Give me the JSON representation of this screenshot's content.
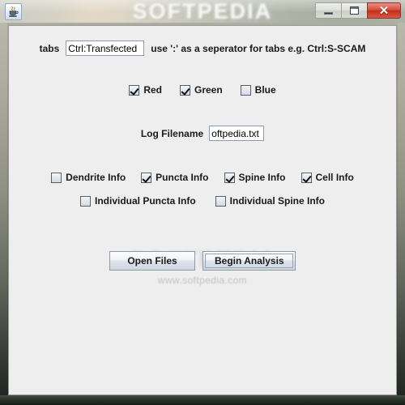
{
  "window": {
    "title_watermark": "SOFTPEDIA",
    "app_icon": "java-coffee-cup-icon",
    "minimize_label": "",
    "maximize_label": "",
    "close_label": "✕"
  },
  "form": {
    "tabs_label": "tabs",
    "tabs_value": "Ctrl:Transfected",
    "tabs_hint": "use ':' as a seperator for tabs e.g. Ctrl:S-SCAM",
    "log_label": "Log Filename",
    "log_value": "oftpedia.txt",
    "channels": [
      {
        "label": "Red",
        "checked": true
      },
      {
        "label": "Green",
        "checked": true
      },
      {
        "label": "Blue",
        "checked": false
      }
    ],
    "info_options": [
      {
        "label": "Dendrite Info",
        "checked": false
      },
      {
        "label": "Puncta Info",
        "checked": true
      },
      {
        "label": "Spine Info",
        "checked": true
      },
      {
        "label": "Cell Info",
        "checked": true
      }
    ],
    "individual_options": [
      {
        "label": "Individual Puncta Info",
        "checked": false
      },
      {
        "label": "Individual Spine Info",
        "checked": false
      }
    ]
  },
  "buttons": {
    "open_files": "Open Files",
    "begin_analysis": "Begin Analysis"
  },
  "watermarks": {
    "body": "www.softpedia.com",
    "body_big": "SOFTPEDIA"
  },
  "colors": {
    "client_background": "#eeeeee",
    "close_button": "#c32d18",
    "text": "#1a1a1a",
    "field_border": "#8b9bb5"
  }
}
